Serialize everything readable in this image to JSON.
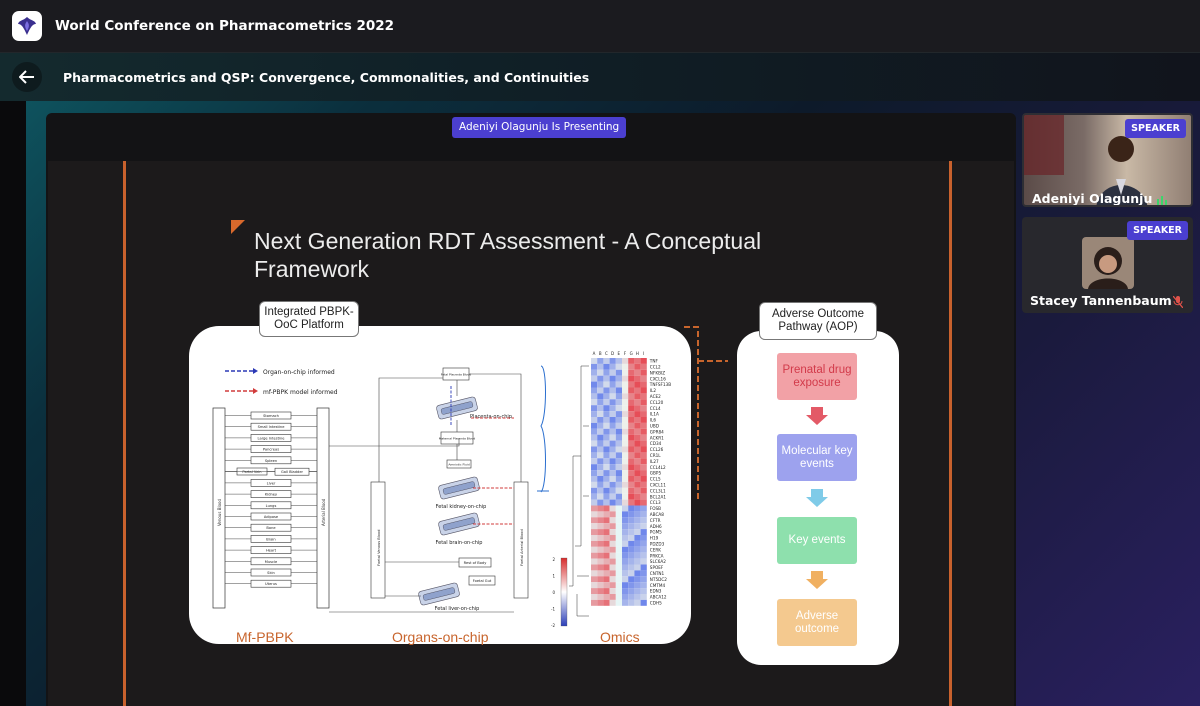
{
  "app": {
    "title": "World Conference on Pharmacometrics 2022"
  },
  "session": {
    "title": "Pharmacometrics and QSP: Convergence, Commonalities, and Continuities"
  },
  "presenting_banner": "Adeniyi Olagunju Is Presenting",
  "slide": {
    "title": "Next Generation RDT Assessment - A Conceptual Framework",
    "platform_label": "Integrated PBPK-OoC Platform",
    "aop_label": "Adverse Outcome Pathway (AOP)",
    "bottom_labels": [
      "Mf-PBPK",
      "Organs-on-chip",
      "Omics"
    ],
    "legend": [
      "Organ-on-chip informed",
      "mf-PBPK model informed"
    ],
    "pbpk_organs": [
      "Stomach",
      "Small Intestine",
      "Large Intestine",
      "Pancreas",
      "Spleen",
      "Portal Vein",
      "Gall Bladder",
      "Liver",
      "Kidney",
      "Lungs",
      "Adipose",
      "Bone",
      "Brain",
      "Heart",
      "Muscle",
      "Skin",
      "Uterus"
    ],
    "pbpk_side_labels": [
      "Venous Blood",
      "Arterial Blood"
    ],
    "chip_labels": [
      "Fetal Placenta Blood",
      "Placenta-on-chip",
      "Maternal Placenta Blood",
      "Amniotic Fluid",
      "Fetal kidney-on-chip",
      "Fetal brain-on-chip",
      "Rest of Body",
      "Foetal Gut",
      "Fetal liver-on-chip",
      "Foetal Venous Blood",
      "Foetal Arterial Blood"
    ],
    "heatmap_columns": [
      "A",
      "B",
      "C",
      "D",
      "E",
      "F",
      "G",
      "H",
      "I"
    ],
    "heatmap_genes": [
      "TNF",
      "CCL2",
      "NFKBIZ",
      "CXCL16",
      "TNFSF13B",
      "IL2",
      "ACE2",
      "CCL20",
      "CCL4",
      "IL1A",
      "IL6",
      "UBD",
      "GPR84",
      "ACKR1",
      "CD34",
      "CCL26",
      "CR1L",
      "IL27",
      "CCL4L2",
      "GBP5",
      "CCL5",
      "CXCL11",
      "CCL3L1",
      "BCL2A1",
      "CCL3",
      "FOSB",
      "ABCA8",
      "CFTR",
      "ADH6",
      "PGM5",
      "H19",
      "PDZD3",
      "CERK",
      "PRKCA",
      "SLC6A2",
      "SPOEF",
      "CNTN1",
      "NT5DC2",
      "CMTM4",
      "EDN3",
      "ABCA12",
      "CDH5"
    ],
    "heatmap_scale": [
      "2",
      "1",
      "0",
      "-1",
      "-2"
    ],
    "aop_steps": [
      {
        "label": "Prenatal drug exposure",
        "color": "#f2a1a6",
        "text_color": "#d23a4a"
      },
      {
        "label": "Molecular key events",
        "color": "#9da2ee",
        "text_color": "#ffffff"
      },
      {
        "label": "Key events",
        "color": "#8ee0ad",
        "text_color": "#ffffff"
      },
      {
        "label": "Adverse outcome",
        "color": "#f4c98f",
        "text_color": "#ffffff"
      }
    ]
  },
  "participants": [
    {
      "name": "Adeniyi Olagunju",
      "badge": "SPEAKER",
      "speaking": true
    },
    {
      "name": "Stacey Tannenbaum",
      "badge": "SPEAKER",
      "muted": true
    }
  ],
  "colors": {
    "accent": "#4b3fd0",
    "slide_orange": "#c8652d"
  }
}
